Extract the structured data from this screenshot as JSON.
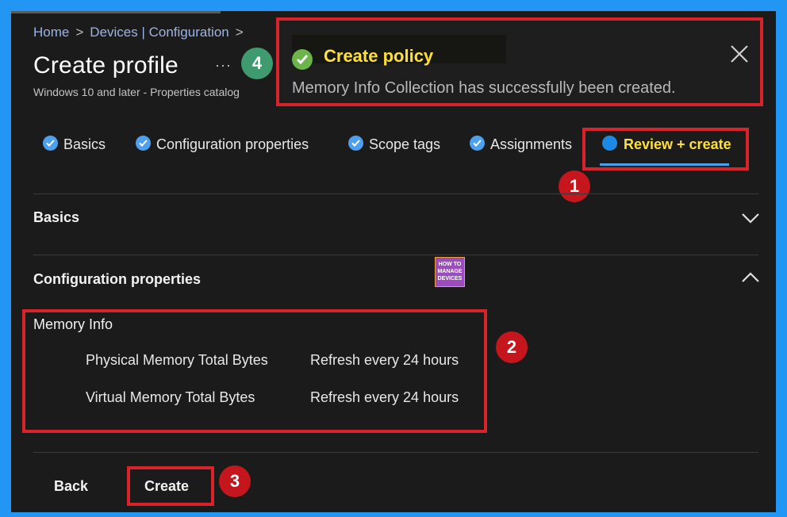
{
  "breadcrumb": {
    "items": [
      "Home",
      "Devices | Configuration"
    ],
    "separator": ">"
  },
  "header": {
    "title": "Create profile",
    "more": "···",
    "subtitle": "Windows 10 and later - Properties catalog"
  },
  "toast": {
    "title": "Create policy",
    "message": "Memory Info Collection has successfully been created.",
    "status_color": "#6bb54a",
    "title_color": "#ffe03a"
  },
  "tabs": [
    {
      "label": "Basics",
      "state": "complete"
    },
    {
      "label": "Configuration properties",
      "state": "complete"
    },
    {
      "label": "Scope tags",
      "state": "complete"
    },
    {
      "label": "Assignments",
      "state": "complete"
    },
    {
      "label": "Review + create",
      "state": "active"
    }
  ],
  "sections": {
    "basics": {
      "label": "Basics",
      "expanded": false
    },
    "configuration": {
      "label": "Configuration properties",
      "expanded": true
    }
  },
  "memory_info": {
    "title": "Memory Info",
    "rows": [
      {
        "name": "Physical Memory Total Bytes",
        "value": "Refresh every 24 hours"
      },
      {
        "name": "Virtual Memory Total Bytes",
        "value": "Refresh every 24 hours"
      }
    ]
  },
  "footer": {
    "back_label": "Back",
    "create_label": "Create"
  },
  "logo": {
    "lines": [
      "HOW TO",
      "MANAGE",
      "DEVICES"
    ]
  },
  "annotations": [
    "1",
    "2",
    "3",
    "4"
  ],
  "colors": {
    "accent": "#4da0ee",
    "highlight_box": "#d8232a",
    "marker_red": "#c4161c",
    "marker_green": "#3f9b6f",
    "background": "#1b1b1b",
    "border": "#2196f3"
  }
}
